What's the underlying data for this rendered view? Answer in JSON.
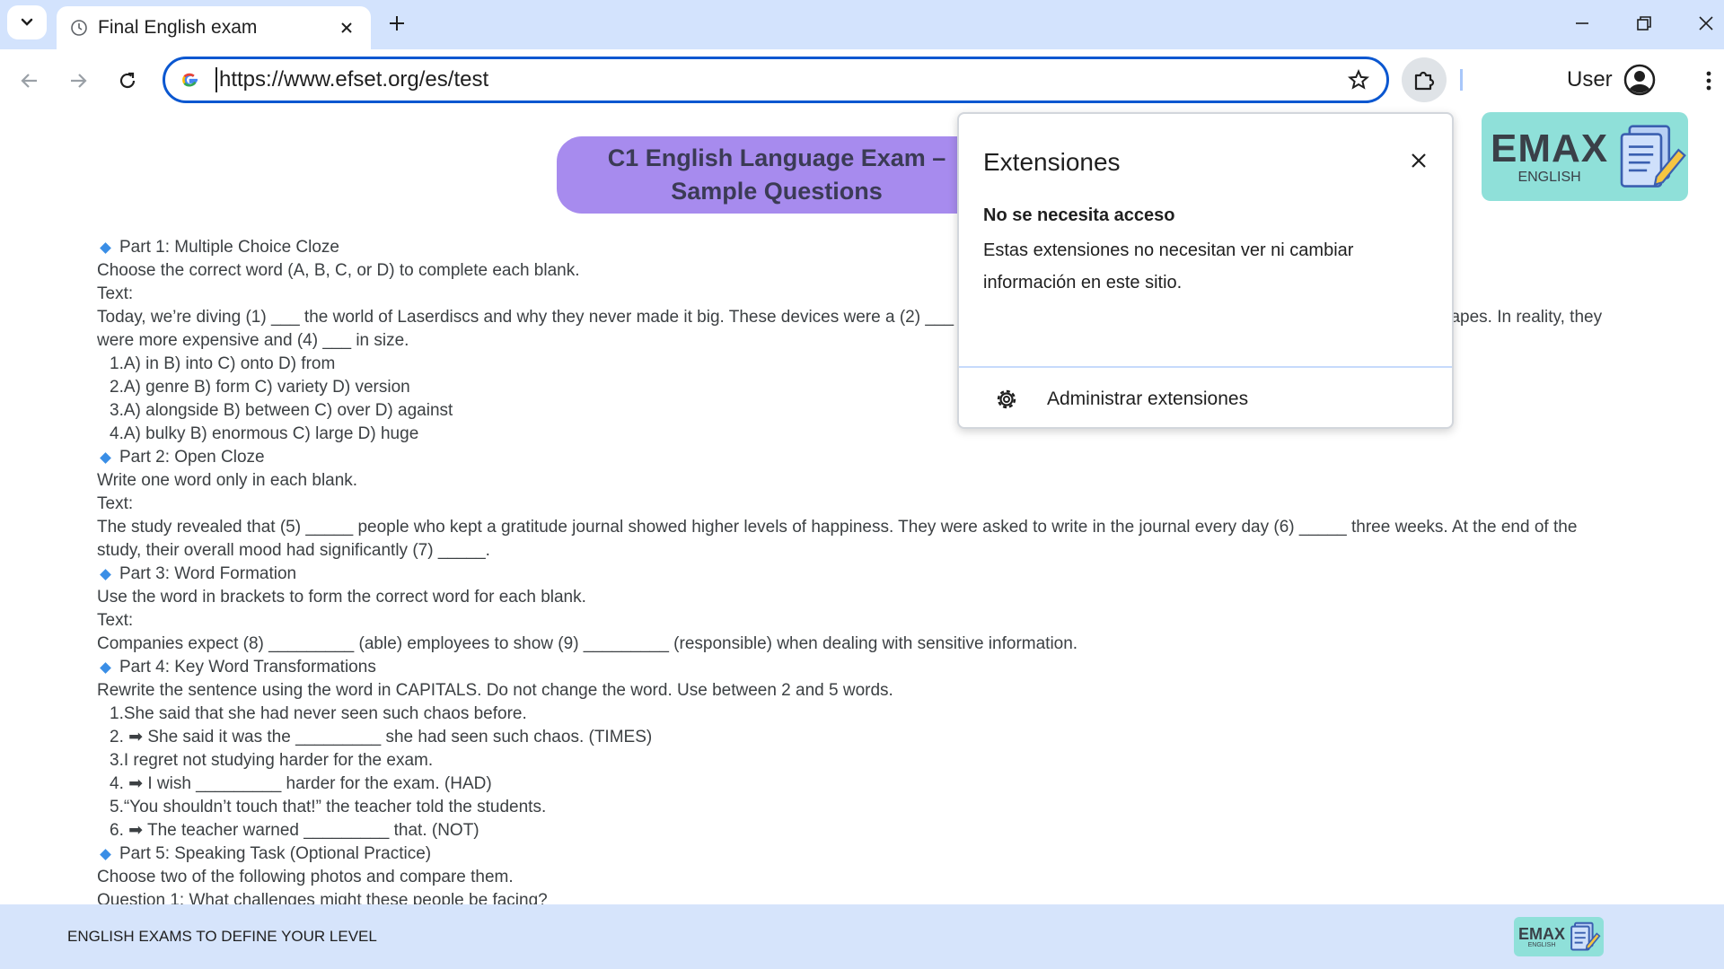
{
  "browser": {
    "tab": {
      "title": "Final English exam"
    },
    "omnibox": {
      "url": "https://www.efset.org/es/test"
    },
    "profile": {
      "name": "User"
    }
  },
  "page": {
    "banner_title": "C1 English Language Exam –\nSample Questions",
    "logo": {
      "big": "EMAX",
      "small": "ENGLISH"
    },
    "lines": [
      {
        "kind": "head",
        "text": "Part 1: Multiple Choice Cloze"
      },
      {
        "kind": "text",
        "text": "Choose the correct word (A, B, C, or D) to complete each blank."
      },
      {
        "kind": "text",
        "text": "Text:"
      },
      {
        "kind": "para",
        "text": "Today, we’re diving (1) ___ the world of Laserdiscs and why they never made it big. These devices were a (2) ___ of home video technology that promised better quality than VHS tapes. In reality, they were more expensive and (4) ___ in size."
      },
      {
        "kind": "item",
        "text": "1.A) in B) into C) onto D) from"
      },
      {
        "kind": "item",
        "text": "2.A) genre    B) form C) variety    D) version"
      },
      {
        "kind": "item",
        "text": "3.A) alongside    B) between    C) over D) against"
      },
      {
        "kind": "item",
        "text": "4.A) bulky B) enormous    C) large D) huge"
      },
      {
        "kind": "head",
        "text": "Part 2: Open Cloze"
      },
      {
        "kind": "text",
        "text": "Write one word only in each blank."
      },
      {
        "kind": "text",
        "text": "Text:"
      },
      {
        "kind": "para",
        "text": " The study revealed that (5) _____ people who kept a gratitude journal showed higher levels of happiness. They were asked to write in the journal every day (6) _____ three weeks. At the end of the study, their overall mood had significantly (7) _____."
      },
      {
        "kind": "head",
        "text": "Part 3: Word Formation"
      },
      {
        "kind": "text",
        "text": "Use the word in brackets to form the correct word for each blank."
      },
      {
        "kind": "text",
        "text": "Text:"
      },
      {
        "kind": "text",
        "text": " Companies expect (8) _________ (able) employees to show (9) _________ (responsible) when dealing with sensitive information."
      },
      {
        "kind": "head",
        "text": "Part 4: Key Word Transformations"
      },
      {
        "kind": "text",
        "text": "Rewrite the sentence using the word in CAPITALS. Do not change the word. Use between 2 and 5 words."
      },
      {
        "kind": "item",
        "text": "1.She said that she had never seen such chaos before."
      },
      {
        "kind": "item",
        "text": "2. ➡ She said it was the _________ she had seen such chaos. (TIMES)"
      },
      {
        "kind": "item",
        "text": "3.I regret not studying harder for the exam."
      },
      {
        "kind": "item",
        "text": "4. ➡ I wish _________ harder for the exam. (HAD)"
      },
      {
        "kind": "item",
        "text": "5.“You shouldn’t touch that!” the teacher told the students."
      },
      {
        "kind": "item",
        "text": "6. ➡ The teacher warned _________ that. (NOT)"
      },
      {
        "kind": "head",
        "text": "Part 5: Speaking Task (Optional Practice)"
      },
      {
        "kind": "text",
        "text": "Choose two of the following photos and compare them."
      },
      {
        "kind": "text",
        "text": "Question 1: What challenges might these people be facing?"
      }
    ]
  },
  "extensions_popup": {
    "title": "Extensiones",
    "subtitle": "No se necesita acceso",
    "description": "Estas extensiones no necesitan ver ni cambiar información en este sitio.",
    "manage_label": "Administrar extensiones"
  },
  "footer": {
    "text": "ENGLISH EXAMS TO DEFINE YOUR LEVEL",
    "logo_big": "EMAX",
    "logo_small": "ENGLISH"
  }
}
